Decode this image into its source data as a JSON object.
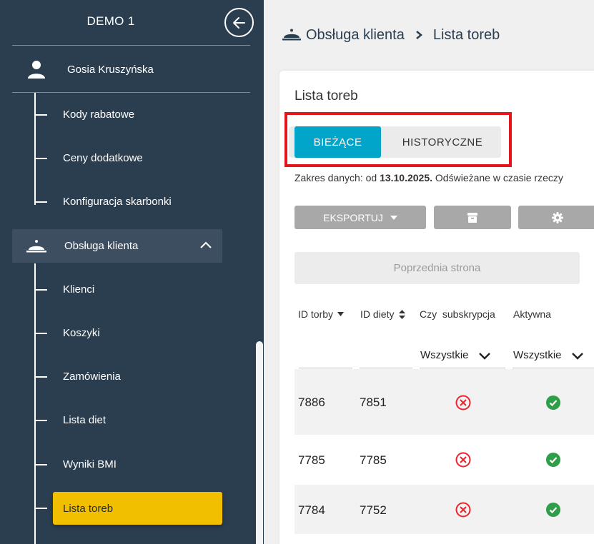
{
  "sidebar": {
    "title": "DEMO 1",
    "user_name": "Gosia Kruszyńska",
    "sub_items_top": [
      {
        "label": "Kody rabatowe"
      },
      {
        "label": "Ceny dodatkowe"
      },
      {
        "label": "Konfiguracja skarbonki"
      }
    ],
    "group": {
      "label": "Obsługa klienta",
      "expanded": true
    },
    "group_items": [
      {
        "label": "Klienci"
      },
      {
        "label": "Koszyki"
      },
      {
        "label": "Zamówienia"
      },
      {
        "label": "Lista diet"
      },
      {
        "label": "Wyniki BMI"
      }
    ],
    "active_item": {
      "label": "Lista toreb"
    },
    "colors": {
      "background": "#2b3e50",
      "active": "#f1bf00"
    }
  },
  "breadcrumb": {
    "section": "Obsługa klienta",
    "page": "Lista toreb"
  },
  "card": {
    "title": "Lista toreb",
    "tabs": {
      "current": "BIEŻĄCE",
      "history": "HISTORYCZNE",
      "active": "current"
    },
    "date_range": {
      "prefix": "Zakres danych: od ",
      "date": "13.10.2025.",
      "suffix": " Odświeżane w czasie rzeczy"
    },
    "toolbar": {
      "export_label": "EKSPORTUJ"
    },
    "prev_page_label": "Poprzednia strona",
    "columns": [
      {
        "label": "ID torby"
      },
      {
        "label": "ID diety"
      },
      {
        "label": "Czy  subskrypcja"
      },
      {
        "label": "Aktywna"
      }
    ],
    "filters": {
      "subscription": "Wszystkie",
      "active": "Wszystkie"
    },
    "rows": [
      {
        "bag_id": "7886",
        "diet_id": "7851",
        "subscription": false,
        "active": true
      },
      {
        "bag_id": "7785",
        "diet_id": "7785",
        "subscription": false,
        "active": true
      },
      {
        "bag_id": "7784",
        "diet_id": "7752",
        "subscription": false,
        "active": true
      }
    ]
  },
  "colors": {
    "accent": "#00a5c9",
    "highlight": "#e8141c",
    "error": "#e8252d",
    "success": "#2e9e48"
  }
}
